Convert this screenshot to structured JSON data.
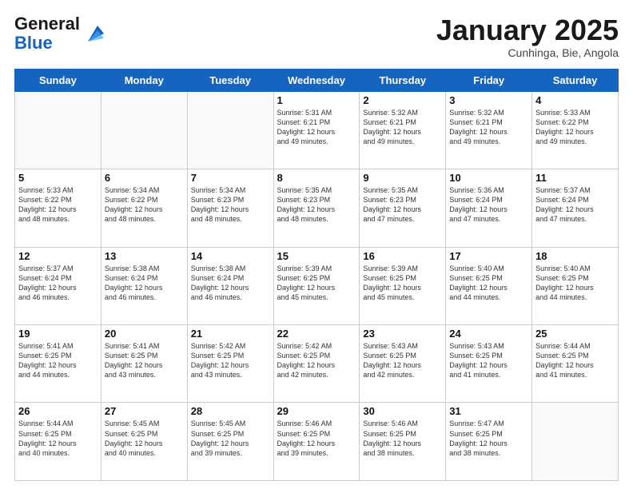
{
  "header": {
    "logo_general": "General",
    "logo_blue": "Blue",
    "month_title": "January 2025",
    "subtitle": "Cunhinga, Bie, Angola"
  },
  "weekdays": [
    "Sunday",
    "Monday",
    "Tuesday",
    "Wednesday",
    "Thursday",
    "Friday",
    "Saturday"
  ],
  "weeks": [
    [
      {
        "day": "",
        "info": ""
      },
      {
        "day": "",
        "info": ""
      },
      {
        "day": "",
        "info": ""
      },
      {
        "day": "1",
        "info": "Sunrise: 5:31 AM\nSunset: 6:21 PM\nDaylight: 12 hours\nand 49 minutes."
      },
      {
        "day": "2",
        "info": "Sunrise: 5:32 AM\nSunset: 6:21 PM\nDaylight: 12 hours\nand 49 minutes."
      },
      {
        "day": "3",
        "info": "Sunrise: 5:32 AM\nSunset: 6:21 PM\nDaylight: 12 hours\nand 49 minutes."
      },
      {
        "day": "4",
        "info": "Sunrise: 5:33 AM\nSunset: 6:22 PM\nDaylight: 12 hours\nand 49 minutes."
      }
    ],
    [
      {
        "day": "5",
        "info": "Sunrise: 5:33 AM\nSunset: 6:22 PM\nDaylight: 12 hours\nand 48 minutes."
      },
      {
        "day": "6",
        "info": "Sunrise: 5:34 AM\nSunset: 6:22 PM\nDaylight: 12 hours\nand 48 minutes."
      },
      {
        "day": "7",
        "info": "Sunrise: 5:34 AM\nSunset: 6:23 PM\nDaylight: 12 hours\nand 48 minutes."
      },
      {
        "day": "8",
        "info": "Sunrise: 5:35 AM\nSunset: 6:23 PM\nDaylight: 12 hours\nand 48 minutes."
      },
      {
        "day": "9",
        "info": "Sunrise: 5:35 AM\nSunset: 6:23 PM\nDaylight: 12 hours\nand 47 minutes."
      },
      {
        "day": "10",
        "info": "Sunrise: 5:36 AM\nSunset: 6:24 PM\nDaylight: 12 hours\nand 47 minutes."
      },
      {
        "day": "11",
        "info": "Sunrise: 5:37 AM\nSunset: 6:24 PM\nDaylight: 12 hours\nand 47 minutes."
      }
    ],
    [
      {
        "day": "12",
        "info": "Sunrise: 5:37 AM\nSunset: 6:24 PM\nDaylight: 12 hours\nand 46 minutes."
      },
      {
        "day": "13",
        "info": "Sunrise: 5:38 AM\nSunset: 6:24 PM\nDaylight: 12 hours\nand 46 minutes."
      },
      {
        "day": "14",
        "info": "Sunrise: 5:38 AM\nSunset: 6:24 PM\nDaylight: 12 hours\nand 46 minutes."
      },
      {
        "day": "15",
        "info": "Sunrise: 5:39 AM\nSunset: 6:25 PM\nDaylight: 12 hours\nand 45 minutes."
      },
      {
        "day": "16",
        "info": "Sunrise: 5:39 AM\nSunset: 6:25 PM\nDaylight: 12 hours\nand 45 minutes."
      },
      {
        "day": "17",
        "info": "Sunrise: 5:40 AM\nSunset: 6:25 PM\nDaylight: 12 hours\nand 44 minutes."
      },
      {
        "day": "18",
        "info": "Sunrise: 5:40 AM\nSunset: 6:25 PM\nDaylight: 12 hours\nand 44 minutes."
      }
    ],
    [
      {
        "day": "19",
        "info": "Sunrise: 5:41 AM\nSunset: 6:25 PM\nDaylight: 12 hours\nand 44 minutes."
      },
      {
        "day": "20",
        "info": "Sunrise: 5:41 AM\nSunset: 6:25 PM\nDaylight: 12 hours\nand 43 minutes."
      },
      {
        "day": "21",
        "info": "Sunrise: 5:42 AM\nSunset: 6:25 PM\nDaylight: 12 hours\nand 43 minutes."
      },
      {
        "day": "22",
        "info": "Sunrise: 5:42 AM\nSunset: 6:25 PM\nDaylight: 12 hours\nand 42 minutes."
      },
      {
        "day": "23",
        "info": "Sunrise: 5:43 AM\nSunset: 6:25 PM\nDaylight: 12 hours\nand 42 minutes."
      },
      {
        "day": "24",
        "info": "Sunrise: 5:43 AM\nSunset: 6:25 PM\nDaylight: 12 hours\nand 41 minutes."
      },
      {
        "day": "25",
        "info": "Sunrise: 5:44 AM\nSunset: 6:25 PM\nDaylight: 12 hours\nand 41 minutes."
      }
    ],
    [
      {
        "day": "26",
        "info": "Sunrise: 5:44 AM\nSunset: 6:25 PM\nDaylight: 12 hours\nand 40 minutes."
      },
      {
        "day": "27",
        "info": "Sunrise: 5:45 AM\nSunset: 6:25 PM\nDaylight: 12 hours\nand 40 minutes."
      },
      {
        "day": "28",
        "info": "Sunrise: 5:45 AM\nSunset: 6:25 PM\nDaylight: 12 hours\nand 39 minutes."
      },
      {
        "day": "29",
        "info": "Sunrise: 5:46 AM\nSunset: 6:25 PM\nDaylight: 12 hours\nand 39 minutes."
      },
      {
        "day": "30",
        "info": "Sunrise: 5:46 AM\nSunset: 6:25 PM\nDaylight: 12 hours\nand 38 minutes."
      },
      {
        "day": "31",
        "info": "Sunrise: 5:47 AM\nSunset: 6:25 PM\nDaylight: 12 hours\nand 38 minutes."
      },
      {
        "day": "",
        "info": ""
      }
    ]
  ]
}
